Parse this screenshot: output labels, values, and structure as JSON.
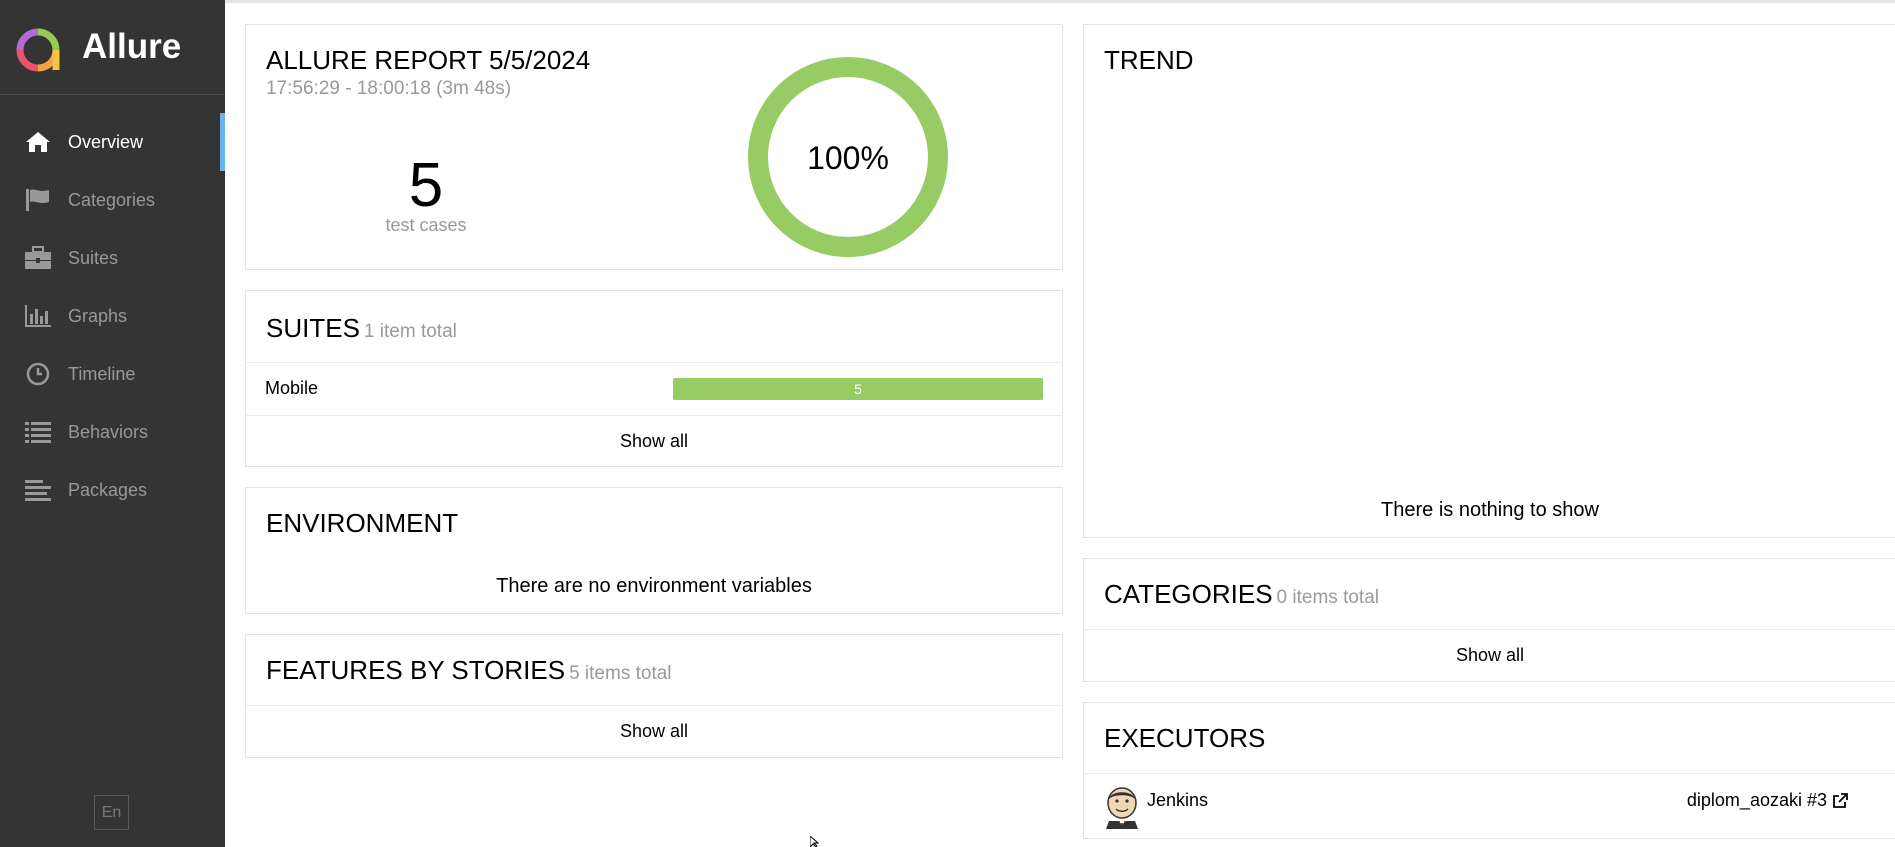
{
  "app": {
    "name": "Allure"
  },
  "sidebar": {
    "items": [
      {
        "label": "Overview",
        "icon": "home-icon",
        "active": true
      },
      {
        "label": "Categories",
        "icon": "flag-icon"
      },
      {
        "label": "Suites",
        "icon": "briefcase-icon"
      },
      {
        "label": "Graphs",
        "icon": "bar-chart-icon"
      },
      {
        "label": "Timeline",
        "icon": "clock-icon"
      },
      {
        "label": "Behaviors",
        "icon": "list-icon"
      },
      {
        "label": "Packages",
        "icon": "align-left-icon"
      }
    ],
    "language": "En"
  },
  "summary": {
    "title": "ALLURE REPORT 5/5/2024",
    "time": "17:56:29 - 18:00:18 (3m 48s)",
    "count": "5",
    "count_label": "test cases",
    "percent": "100%",
    "pass_fraction": 1.0,
    "color": "#97cc64"
  },
  "suites": {
    "title": "SUITES",
    "subtitle": "1 item total",
    "items": [
      {
        "name": "Mobile",
        "passed": "5"
      }
    ],
    "show_all": "Show all"
  },
  "environment": {
    "title": "ENVIRONMENT",
    "empty": "There are no environment variables"
  },
  "features": {
    "title": "FEATURES BY STORIES",
    "subtitle": "5 items total",
    "show_all": "Show all"
  },
  "trend": {
    "title": "TREND",
    "empty": "There is nothing to show"
  },
  "categories": {
    "title": "CATEGORIES",
    "subtitle": "0 items total",
    "show_all": "Show all"
  },
  "executors": {
    "title": "EXECUTORS",
    "name": "Jenkins",
    "build": "diplom_aozaki #3"
  }
}
